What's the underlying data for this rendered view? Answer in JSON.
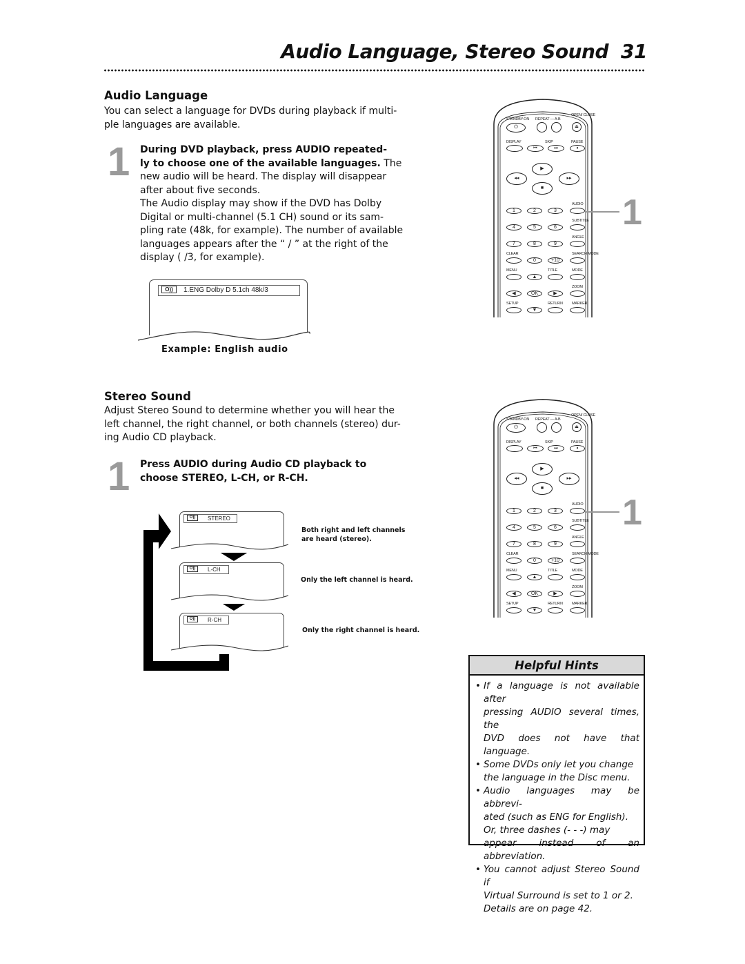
{
  "header": {
    "title": "Audio Language, Stereo Sound",
    "page_number": "31"
  },
  "audio_language": {
    "heading": "Audio Language",
    "intro": [
      "You can select a language for DVDs during playback if multi-",
      "ple languages are available."
    ],
    "step": {
      "number": "1",
      "bold_lines": [
        "During DVD playback, press AUDIO repeated-",
        "ly to choose one of the available languages."
      ],
      "tail_first": " The",
      "lines": [
        "new audio will be heard. The display will disappear",
        "after about five seconds.",
        "The Audio display may show if the DVD has Dolby",
        "Digital or multi-channel (5.1 CH) sound or its sam-",
        "pling rate (48k, for example). The number of available",
        "languages appears after the “ / ” at the right of the",
        "display ( /3, for example)."
      ]
    },
    "osd": {
      "icon": "O))",
      "text": "1.ENG Dolby D 5.1ch 48k/3"
    },
    "caption": "Example: English audio"
  },
  "stereo_sound": {
    "heading": "Stereo Sound",
    "intro": [
      "Adjust Stereo Sound to determine whether you will hear the",
      "left channel, the right channel, or both channels (stereo) dur-",
      "ing Audio CD playback."
    ],
    "step": {
      "number": "1",
      "bold_lines": [
        "Press AUDIO during Audio CD playback to",
        "choose STEREO, L-CH, or R-CH."
      ]
    },
    "modes": [
      {
        "icon": "O))",
        "label": "STEREO",
        "description": [
          "Both right and left channels",
          "are heard (stereo)."
        ]
      },
      {
        "icon": "O))",
        "label": "L-CH",
        "description": [
          "Only the left channel is heard."
        ]
      },
      {
        "icon": "O))",
        "label": "R-CH",
        "description": [
          "Only the right channel is heard."
        ]
      }
    ]
  },
  "remote": {
    "callout_number": "1",
    "labels": {
      "standby": "STANDBY-ON",
      "repeat": "REPEAT — A-B",
      "open_close": "OPEN/ CLOSE",
      "display": "DISPLAY",
      "skip": "SKIP",
      "pause": "PAUSE",
      "audio": "AUDIO",
      "subtitle": "SUBTITLE",
      "angle": "ANGLE",
      "clear": "CLEAR",
      "search_mode": "SEARCH MODE",
      "menu": "MENU",
      "title": "TITLE",
      "mode": "MODE",
      "zoom": "ZOOM",
      "setup": "SETUP",
      "return": "RETURN",
      "marker": "MARKER"
    },
    "number_keys": [
      "1",
      "2",
      "3",
      "4",
      "5",
      "6",
      "7",
      "8",
      "9",
      "0",
      "+10"
    ],
    "ok": "OK"
  },
  "helpful_hints": {
    "heading": "Helpful Hints",
    "items": [
      [
        "If a language is not available after",
        "pressing AUDIO several times, the",
        "DVD does not have that language."
      ],
      [
        "Some DVDs only let you change",
        "the language in the Disc menu."
      ],
      [
        "Audio languages may be abbrevi-",
        "ated (such as ENG for English).",
        "Or, three dashes (- - -) may",
        "appear instead of an abbreviation."
      ],
      [
        "You cannot adjust Stereo Sound if",
        "Virtual Surround is set to 1 or 2.",
        "Details are on page 42."
      ]
    ]
  }
}
